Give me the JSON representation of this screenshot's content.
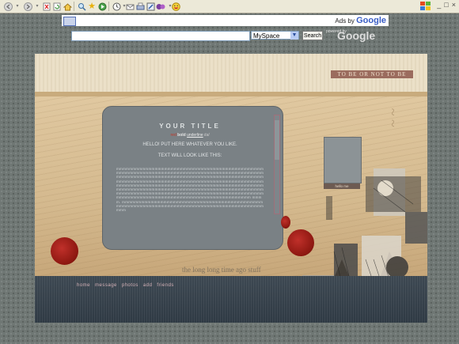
{
  "browser": {
    "toolbar_icons": [
      "back-icon",
      "forward-icon",
      "stop-icon",
      "refresh-icon",
      "home-icon",
      "search-icon",
      "favorites-icon",
      "media-icon",
      "history-icon",
      "mail-icon",
      "print-icon",
      "edit-icon",
      "messenger-icon",
      "smiley-icon"
    ],
    "window_controls": [
      "_",
      "□",
      "×"
    ]
  },
  "ads": {
    "prefix": "Ads by",
    "brand": "Google"
  },
  "search": {
    "input_value": "",
    "select_value": "MySpace",
    "button_label": "Search",
    "powered_prefix": "powered by",
    "powered_brand": "Google"
  },
  "profile": {
    "tagline": "TO BE OR NOT TO BE",
    "title": "YOUR TITLE",
    "styles": {
      "red": "red",
      "bold": "bold",
      "underline": "underline",
      "italic": "ital"
    },
    "line1": "HELLO! PUT HERE WHATEVER YOU LIKE.",
    "line2": "TEXT WILL LOOK LIKE THIS:",
    "filler": "mmmmmmmmmmmmmmmmmmmmmmmmmmmmmmmmmmmmmmmmmmmmmmmmmmmmmmmmmmmmmmmmmmmmmmmmmmmmmmmmmmmmmmmmmmmmmmmmmmmmmmmmmmmmmmmmmmmmmmmmmmmmmmmmmmmmmmmmmmmmmmmmmmmmmmmmmmmmmmmmmmmmmmmmmmmmmmmmmmmmmmmmmmmmmmmmmmmmmmmmmmmmmmmmmmmmmmmmmmmmmmmmmmmmmmmmmmmmmmmmmmmmmmmmmmmmmmmmmmmmmmmmmmmmmmmmmmmmmmmmmmmmmmmmmmmmmmmmmmmmmmmmmmmmmmmmmmmmmmmmmmmmmmmmmmmmmmmmmmmmmmmmmmmmmmmmmmmmmmmmmmmm mmmm. mmmmmmmmmmmmmmmmmmmmmmmmmmmmmmmmmmmmmmmmmmmmmmmmmmmmmmmmmmmmmmmmmmmmmmmmmmmmmmmmmmmmmmmmmmmmm",
    "pic_label": "hello me",
    "footer_text": "the long long time ago stuff",
    "nav": [
      "home",
      "message",
      "photos",
      "add",
      "friends"
    ]
  },
  "colors": {
    "accent": "#9b6c5e",
    "panel": "#7a8185",
    "nav_band": "#34404a",
    "nav_link": "#d5b2b8"
  }
}
